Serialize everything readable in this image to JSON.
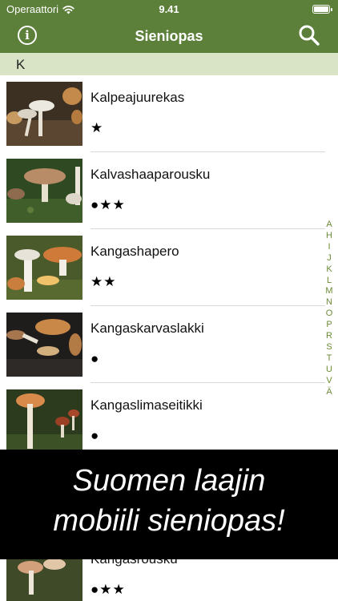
{
  "status_bar": {
    "carrier": "Operaattori",
    "time": "9.41",
    "wifi_icon": "wifi-icon",
    "battery_icon": "battery-icon"
  },
  "nav": {
    "title": "Sieniopas",
    "info_icon": "info-icon",
    "info_glyph": "i",
    "search_icon": "search-icon"
  },
  "section": {
    "letter": "K"
  },
  "items": [
    {
      "name": "Kalpeajuurekas",
      "rating": "★"
    },
    {
      "name": "Kalvashaaparousku",
      "rating": "●★★"
    },
    {
      "name": "Kangashapero",
      "rating": "★★"
    },
    {
      "name": "Kangaskarvaslakki",
      "rating": "●"
    },
    {
      "name": "Kangaslimaseitikki",
      "rating": "●"
    },
    {
      "name": "Kangasrousku",
      "rating": "●★★"
    }
  ],
  "index_letters": [
    "A",
    "H",
    "I",
    "J",
    "K",
    "L",
    "M",
    "N",
    "O",
    "P",
    "R",
    "S",
    "T",
    "U",
    "V",
    "Ä"
  ],
  "promo": {
    "line1": "Suomen laajin",
    "line2": "mobiili sieniopas!"
  },
  "colors": {
    "header_green": "#5c7f3a",
    "section_bg": "#d9e4c6",
    "index_text": "#6b8a36"
  }
}
